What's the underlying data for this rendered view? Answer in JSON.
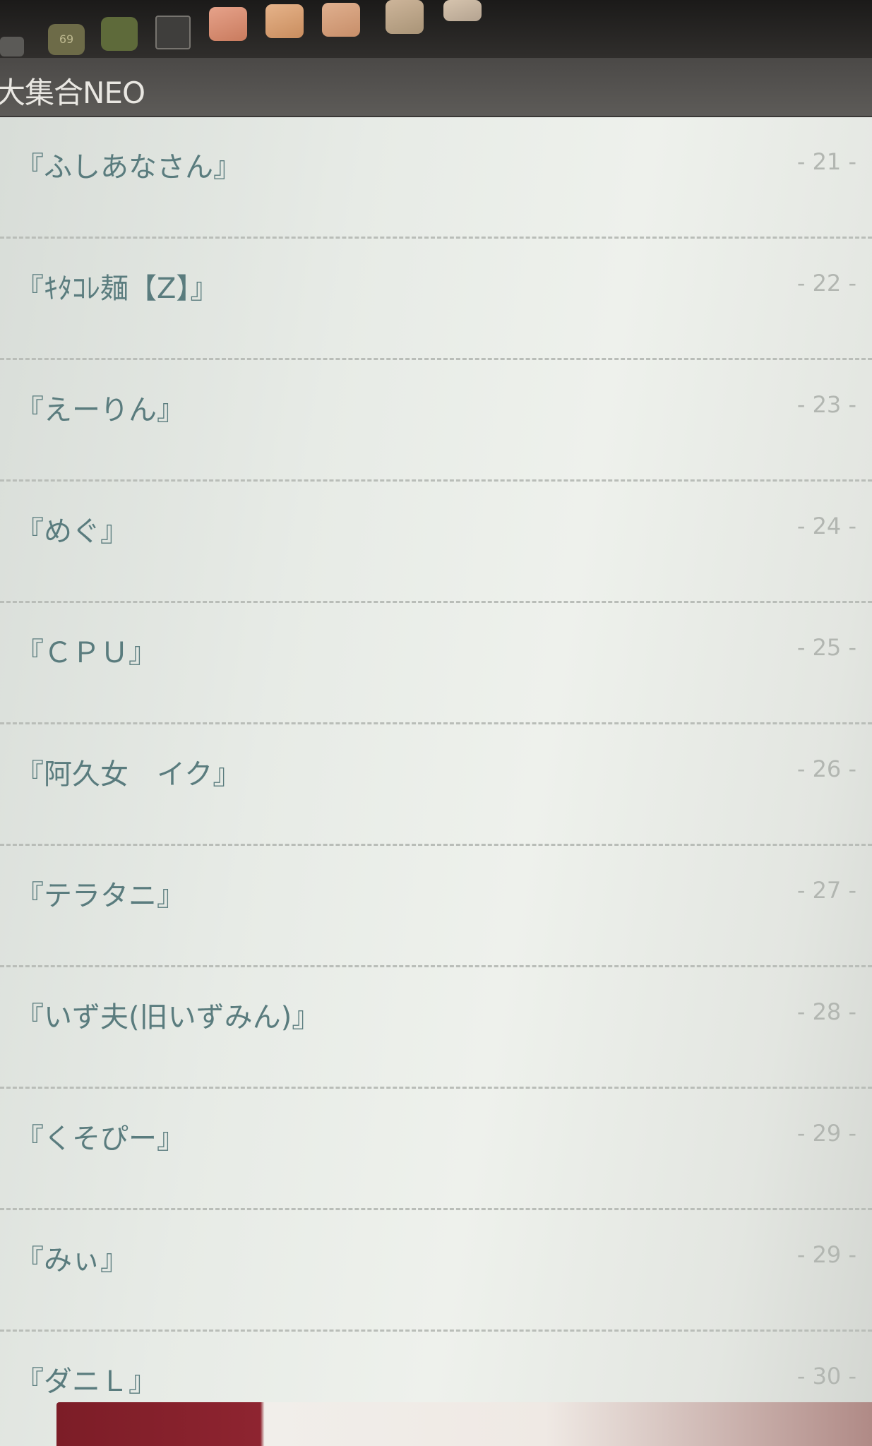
{
  "status_bar": {
    "badge_count": "69",
    "icons": [
      "back-icon",
      "badge-icon",
      "box-icon",
      "gallery-icon",
      "app-icon",
      "app-icon",
      "app-icon",
      "app-icon",
      "app-icon"
    ]
  },
  "header": {
    "title": "大集合NEO"
  },
  "list": {
    "items": [
      {
        "name": "『ふしあなさん』",
        "number": "- 21 -"
      },
      {
        "name": "『ｷﾀｺﾚ麺【Z】』",
        "number": "- 22 -"
      },
      {
        "name": "『えーりん』",
        "number": "- 23 -"
      },
      {
        "name": "『めぐ』",
        "number": "- 24 -"
      },
      {
        "name": "『ＣＰＵ』",
        "number": "- 25 -"
      },
      {
        "name": "『阿久女　イク』",
        "number": "- 26 -"
      },
      {
        "name": "『テラタニ』",
        "number": "- 27 -"
      },
      {
        "name": "『いず夫(旧いずみん)』",
        "number": "- 28 -"
      },
      {
        "name": "『くそぴー』",
        "number": "- 29 -"
      },
      {
        "name": "『みぃ』",
        "number": "- 29 -"
      },
      {
        "name": "『ダニＬ』",
        "number": "- 30 -"
      }
    ]
  },
  "colors": {
    "item_text": "#5a7c7e",
    "number_text": "#b2b6b1",
    "header_bg": "#55534f",
    "banner_accent": "#8e2430"
  }
}
